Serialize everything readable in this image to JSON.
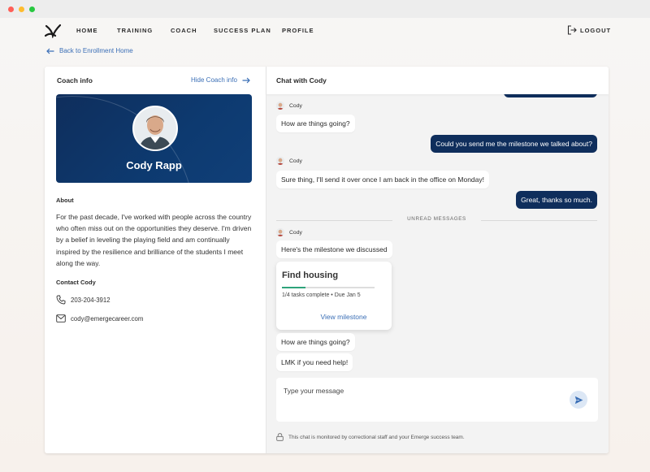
{
  "nav": {
    "items": [
      "HOME",
      "TRAINING",
      "COACH",
      "SUCCESS PLAN",
      "PROFILE"
    ],
    "logout": "LOGOUT"
  },
  "back_link": "Back to Enrollment Home",
  "coach_panel": {
    "title": "Coach info",
    "hide_link": "Hide Coach info",
    "name": "Cody Rapp",
    "about_heading": "About",
    "about_text": "For the past decade, I've worked with people across the country who often miss out on the opportunities they deserve. I'm driven by a belief in leveling the playing field and am continually inspired by the resilience and brilliance of the students I meet along the way.",
    "contact_heading": "Contact Cody",
    "phone": "203-204-3912",
    "email": "cody@emergecareer.com"
  },
  "chat": {
    "title": "Chat with Cody",
    "sender": "Cody",
    "messages": [
      {
        "from": "coach",
        "text": "How are things going?"
      },
      {
        "from": "me",
        "text": "Could you send me the milestone we talked about?"
      },
      {
        "from": "coach",
        "text": "Sure thing, I'll send it over once I am back in the office on Monday!"
      },
      {
        "from": "me",
        "text": "Great, thanks so much."
      },
      {
        "from": "coach",
        "text": "Here's the milestone we discussed"
      },
      {
        "from": "coach",
        "text": "How are things going?"
      },
      {
        "from": "coach",
        "text": "LMK if you need help!"
      }
    ],
    "unread_label": "UNREAD MESSAGES",
    "milestone": {
      "title": "Find housing",
      "meta": "1/4 tasks complete • Due Jan 5",
      "link": "View milestone",
      "progress": 0.25
    },
    "composer_placeholder": "Type your message",
    "notice": "This chat is monitored by correctional staff and your Emerge success team."
  },
  "colors": {
    "brand_navy": "#0f2e5c",
    "link_blue": "#3b6fb6",
    "progress_green": "#2ea37a"
  }
}
